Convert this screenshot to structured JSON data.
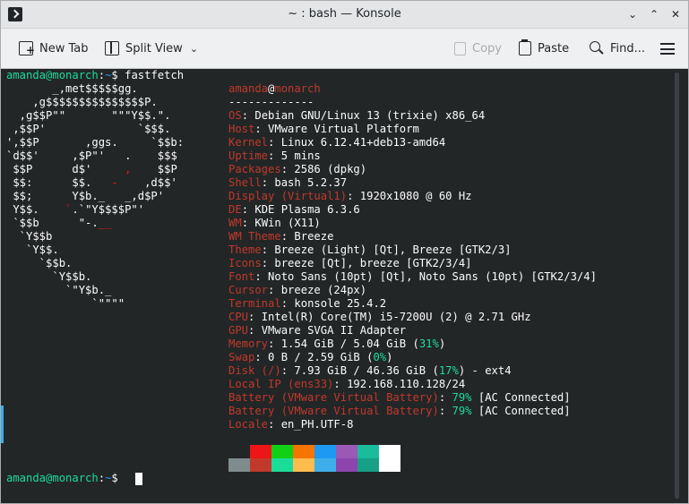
{
  "window": {
    "title": "~ : bash — Konsole",
    "app_icon": "konsole-icon"
  },
  "toolbar": {
    "new_tab": "New Tab",
    "split_view": "Split View",
    "copy": "Copy",
    "paste": "Paste",
    "find": "Find..."
  },
  "colors": {
    "bg": "#232627",
    "fg": "#fcfcfc",
    "green": "#1cdc9a",
    "blue": "#1d99f3",
    "key_red": "#c0392b"
  },
  "prompt": {
    "user_host": "amanda@monarch",
    "sep": ":",
    "path": "~",
    "sigil": "$",
    "command": " fastfetch"
  },
  "logo": [
    "       _,met$$$$$gg.",
    "    ,g$$$$$$$$$$$$$$$P.",
    "  ,g$$P\"\"       \"\"\"Y$$.\".",
    " ,$$P'              `$$$.",
    "',$$P       ,ggs.     `$$b:",
    "`d$$'     ,$P\"'   .    $$$",
    " $$P      d$'     ,    $$P",
    " $$:      $$.   -    ,d$$'",
    " $$;      Y$b._   _,d$P'",
    " Y$$.    `.`\"Y$$$$P\"'",
    " `$$b      \"-.__",
    "  `Y$$b",
    "   `Y$$.",
    "     `$$b.",
    "       `Y$$b.",
    "         `\"Y$b._",
    "             `\"\"\"\""
  ],
  "info": {
    "user": "amanda",
    "at": "@",
    "host": "monarch",
    "underline": "-------------",
    "rows": [
      {
        "key": "OS",
        "value": "Debian GNU/Linux 13 (trixie) x86_64"
      },
      {
        "key": "Host",
        "value": "VMware Virtual Platform"
      },
      {
        "key": "Kernel",
        "value": "Linux 6.12.41+deb13-amd64"
      },
      {
        "key": "Uptime",
        "value": "5 mins"
      },
      {
        "key": "Packages",
        "value": "2586 (dpkg)"
      },
      {
        "key": "Shell",
        "value": "bash 5.2.37"
      },
      {
        "key": "Display (Virtual1)",
        "value": "1920x1080 @ 60 Hz"
      },
      {
        "key": "DE",
        "value": "KDE Plasma 6.3.6"
      },
      {
        "key": "WM",
        "value": "KWin (X11)"
      },
      {
        "key": "WM Theme",
        "value": "Breeze"
      },
      {
        "key": "Theme",
        "value": "Breeze (Light) [Qt], Breeze [GTK2/3]"
      },
      {
        "key": "Icons",
        "value": "breeze [Qt], breeze [GTK2/3/4]"
      },
      {
        "key": "Font",
        "value": "Noto Sans (10pt) [Qt], Noto Sans (10pt) [GTK2/3/4]"
      },
      {
        "key": "Cursor",
        "value": "breeze (24px)"
      },
      {
        "key": "Terminal",
        "value": "konsole 25.4.2"
      },
      {
        "key": "CPU",
        "value": "Intel(R) Core(TM) i5-7200U (2) @ 2.71 GHz"
      },
      {
        "key": "GPU",
        "value": "VMware SVGA II Adapter"
      }
    ],
    "memory": {
      "key": "Memory",
      "a": "1.54 GiB / 5.04 GiB (",
      "pct": "31%",
      "b": ")"
    },
    "swap": {
      "key": "Swap",
      "a": "0 B / 2.59 GiB (",
      "pct": "0%",
      "b": ")"
    },
    "disk": {
      "key": "Disk (/)",
      "a": "7.93 GiB / 46.36 GiB (",
      "pct": "17%",
      "b": ") - ext4"
    },
    "local_ip": {
      "key": "Local IP (ens33)",
      "value": "192.168.110.128/24"
    },
    "battery1": {
      "key": "Battery (VMware Virtual Battery)",
      "pct": "79%",
      "status": " [AC Connected]"
    },
    "battery2": {
      "key": "Battery (VMware Virtual Battery)",
      "pct": "79%",
      "status": " [AC Connected]"
    },
    "locale": {
      "key": "Locale",
      "value": "en_PH.UTF-8"
    }
  },
  "palette": {
    "top": [
      "#232627",
      "#ed1515",
      "#11d116",
      "#f67400",
      "#1d99f3",
      "#9b59b6",
      "#1abc9c",
      "#ffffff"
    ],
    "bottom": [
      "#7f8c8d",
      "#c0392b",
      "#1cdc9a",
      "#fdbc4b",
      "#3daee9",
      "#8e44ad",
      "#16a085",
      "#ffffff"
    ]
  }
}
